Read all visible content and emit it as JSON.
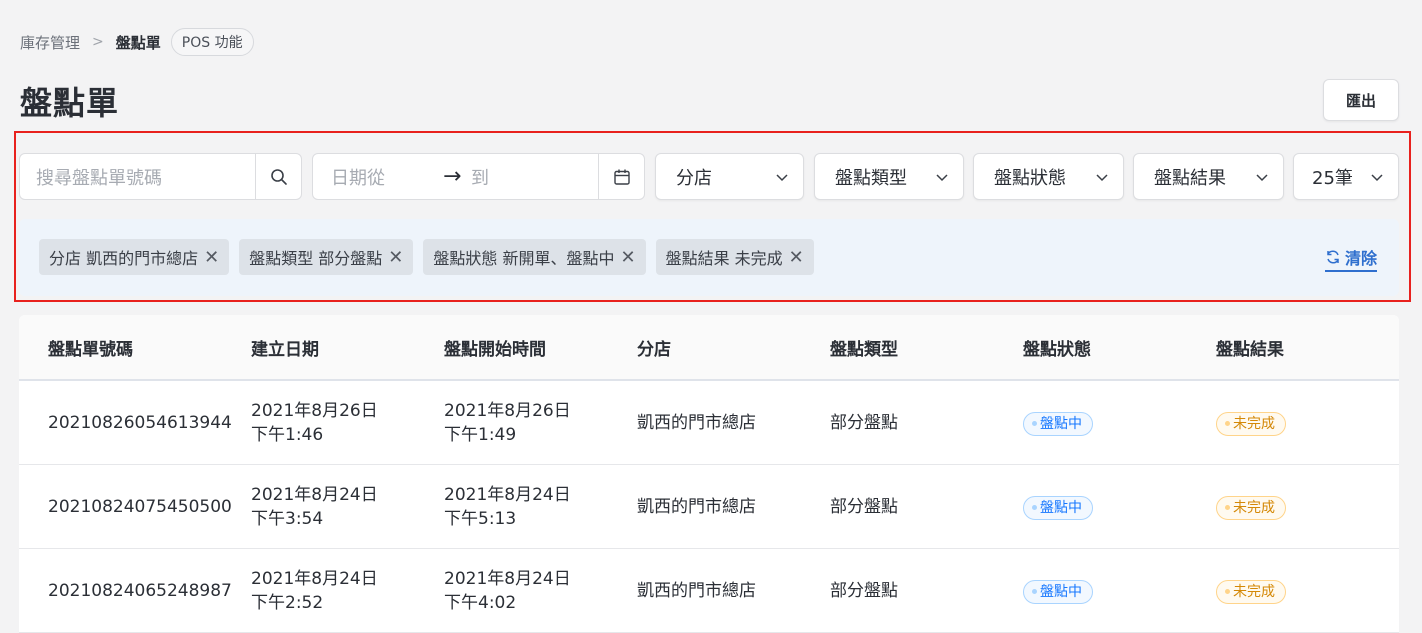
{
  "breadcrumb": {
    "root": "庫存管理",
    "current": "盤點單",
    "tag": "POS 功能"
  },
  "page": {
    "title": "盤點單",
    "export_label": "匯出"
  },
  "filters": {
    "search_placeholder": "搜尋盤點單號碼",
    "date_from_placeholder": "日期從",
    "date_to_placeholder": "到",
    "branch_label": "分店",
    "type_label": "盤點類型",
    "status_label": "盤點狀態",
    "result_label": "盤點結果",
    "page_size_label": "25筆"
  },
  "active_filters": [
    {
      "label": "分店 凱西的門市總店"
    },
    {
      "label": "盤點類型 部分盤點"
    },
    {
      "label": "盤點狀態 新開單、盤點中"
    },
    {
      "label": "盤點結果 未完成"
    }
  ],
  "clear_label": "清除",
  "table": {
    "headers": [
      "盤點單號碼",
      "建立日期",
      "盤點開始時間",
      "分店",
      "盤點類型",
      "盤點狀態",
      "盤點結果"
    ],
    "rows": [
      {
        "id": "20210826054613944",
        "created_date": "2021年8月26日",
        "created_time": "下午1:46",
        "start_date": "2021年8月26日",
        "start_time": "下午1:49",
        "branch": "凱西的門市總店",
        "type": "部分盤點",
        "status": "盤點中",
        "result": "未完成"
      },
      {
        "id": "20210824075450500",
        "created_date": "2021年8月24日",
        "created_time": "下午3:54",
        "start_date": "2021年8月24日",
        "start_time": "下午5:13",
        "branch": "凱西的門市總店",
        "type": "部分盤點",
        "status": "盤點中",
        "result": "未完成"
      },
      {
        "id": "20210824065248987",
        "created_date": "2021年8月24日",
        "created_time": "下午2:52",
        "start_date": "2021年8月24日",
        "start_time": "下午4:02",
        "branch": "凱西的門市總店",
        "type": "部分盤點",
        "status": "盤點中",
        "result": "未完成"
      }
    ]
  },
  "colors": {
    "highlight_border": "#e8211d",
    "link": "#2f6fce",
    "status_blue": "#1677ff",
    "result_gold": "#d48806"
  }
}
